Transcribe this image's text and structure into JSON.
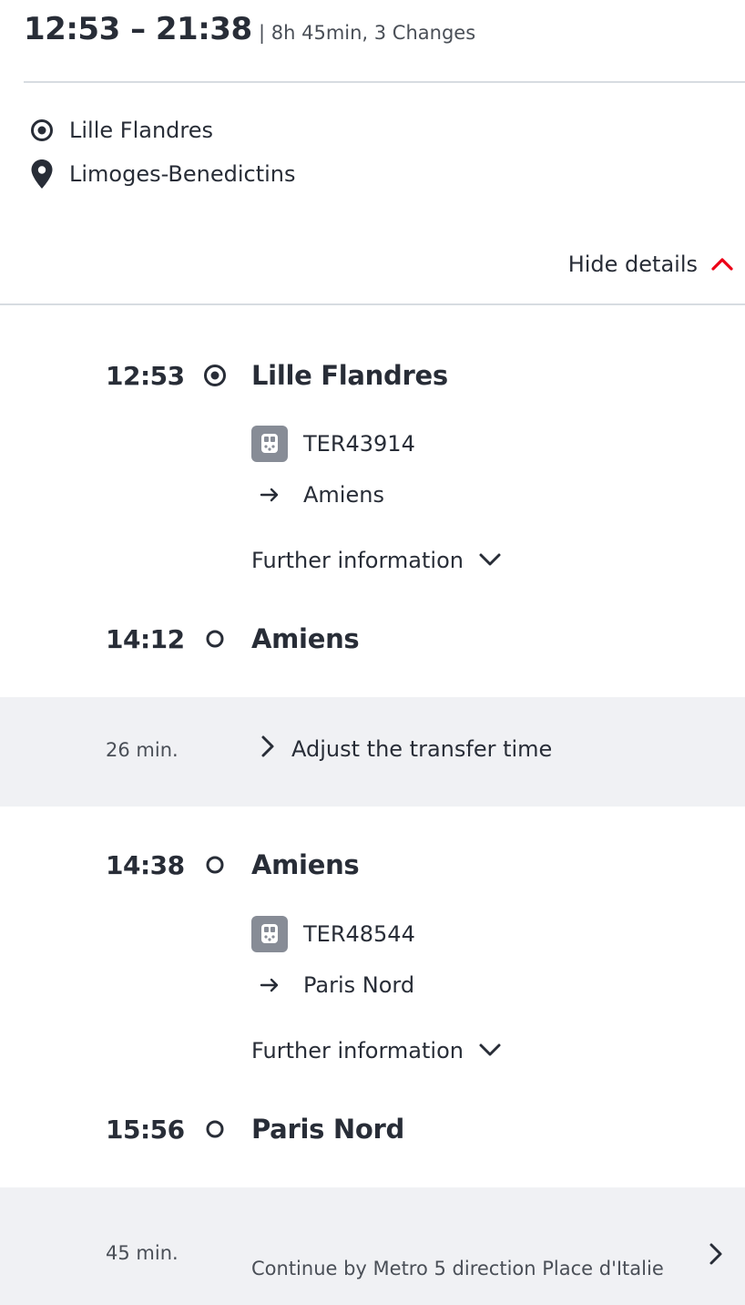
{
  "summary": {
    "time_range": "12:53 – 21:38",
    "meta": "| 8h 45min, 3 Changes"
  },
  "route": {
    "origin": "Lille Flandres",
    "destination": "Limoges-Benedictins",
    "origin_icon": "origin-target-icon",
    "destination_icon": "location-pin-icon"
  },
  "details_toggle": {
    "label": "Hide details",
    "icon": "chevron-up-icon",
    "accent_color": "#ec0016"
  },
  "legs": [
    {
      "departure_time": "12:53",
      "departure_station": "Lille Flandres",
      "train": "TER43914",
      "direction": "Amiens",
      "further_info": "Further information",
      "arrival_time": "14:12",
      "arrival_station": "Amiens"
    },
    {
      "departure_time": "14:38",
      "departure_station": "Amiens",
      "train": "TER48544",
      "direction": "Paris Nord",
      "further_info": "Further information",
      "arrival_time": "15:56",
      "arrival_station": "Paris Nord"
    }
  ],
  "transfers": [
    {
      "duration": "26 min.",
      "action": "Adjust the transfer time"
    },
    {
      "duration": "45 min.",
      "note": "Continue by Metro 5 direction Place d'Italie"
    }
  ],
  "colors": {
    "text": "#282d37",
    "muted": "#4a4f57",
    "divider": "#d7dce1",
    "transfer_bg": "#f0f1f4",
    "train_badge": "#878c96"
  }
}
